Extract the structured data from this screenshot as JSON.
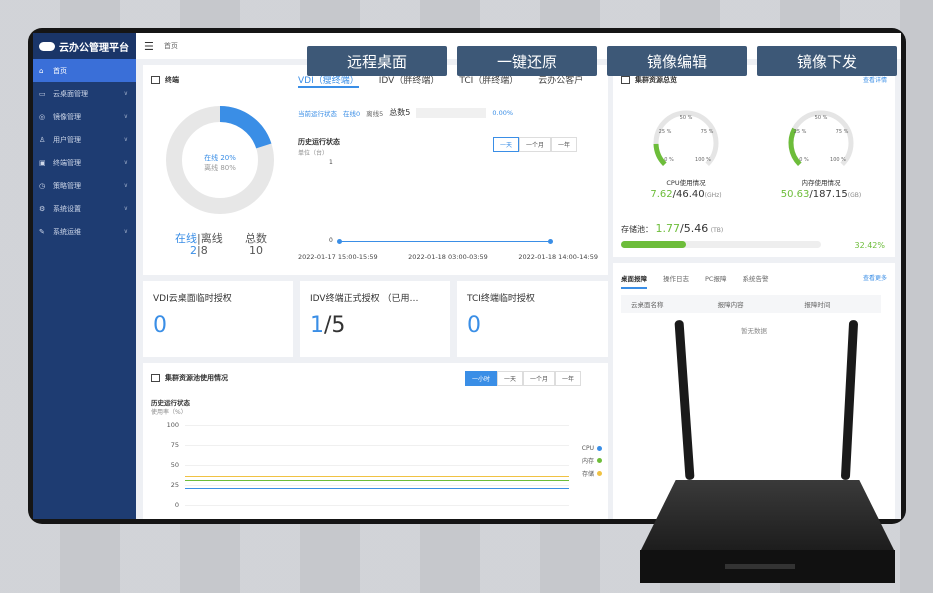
{
  "app": {
    "title": "云办公管理平台",
    "breadcrumb": "首页"
  },
  "sidebar": {
    "items": [
      {
        "label": "首页",
        "icon": "home-icon",
        "glyph": "⌂",
        "active": true
      },
      {
        "label": "云桌面管理",
        "icon": "monitor-icon",
        "glyph": "▭"
      },
      {
        "label": "镜像管理",
        "icon": "disc-icon",
        "glyph": "◎"
      },
      {
        "label": "用户管理",
        "icon": "user-icon",
        "glyph": "♙"
      },
      {
        "label": "终端管理",
        "icon": "terminal-icon",
        "glyph": "▣"
      },
      {
        "label": "策略管理",
        "icon": "clock-icon",
        "glyph": "◷"
      },
      {
        "label": "系统设置",
        "icon": "gear-icon",
        "glyph": "⚙"
      },
      {
        "label": "系统运维",
        "icon": "wrench-icon",
        "glyph": "✎"
      }
    ]
  },
  "banners": [
    "远程桌面",
    "一键还原",
    "镜像编辑",
    "镜像下发"
  ],
  "terminal": {
    "title": "终端",
    "tabs": [
      "VDI（瘦终端）",
      "IDV（胖终端）",
      "TCI（胖终端）",
      "云办公客户"
    ],
    "online_pct": "在线 20%",
    "offline_pct": "离线 80%",
    "online_fraction": 0.2,
    "online_label": "在线",
    "sep": "|",
    "offline_label": "离线",
    "total_label": "总数",
    "online": "2",
    "offline": "8",
    "total": "10",
    "status_line": {
      "label": "当前运行状态",
      "online": "在线0",
      "offline": "离线5",
      "total": "总数5",
      "pct": "0.00%"
    },
    "history": {
      "title": "历史运行状态",
      "unit": "单位（台）",
      "y_top": "1",
      "y_zero": "0",
      "ranges": [
        "一天",
        "一个月",
        "一年"
      ],
      "x_labels": [
        "2022-01-17 15:00-15:59",
        "2022-01-18 03:00-03:59",
        "2022-01-18 14:00-14:59"
      ]
    }
  },
  "licenses": [
    {
      "title": "VDI云桌面临时授权",
      "used": "0",
      "total": ""
    },
    {
      "title": "IDV终端正式授权 （已用…",
      "used": "1",
      "total": "/5"
    },
    {
      "title": "TCI终端临时授权",
      "used": "0",
      "total": ""
    }
  ],
  "pool": {
    "title": "集群资源池使用情况",
    "ranges": [
      "一小时",
      "一天",
      "一个月",
      "一年"
    ],
    "history_title": "历史运行状态",
    "unit": "使用率（%）",
    "y_ticks": [
      "100",
      "75",
      "50",
      "25",
      "0"
    ],
    "legend": [
      {
        "name": "CPU",
        "color": "#3a8ee6"
      },
      {
        "name": "内存",
        "color": "#6dbd3a"
      },
      {
        "name": "存储",
        "color": "#f0c243"
      }
    ]
  },
  "cluster": {
    "title": "集群资源总览",
    "detail_link": "查看详情",
    "gauge_labels": [
      "50 %",
      "25 %",
      "75 %",
      "0 %",
      "100 %"
    ],
    "cpu": {
      "label": "CPU使用情况",
      "used": "7.62",
      "total": "/46.40",
      "unit": "(GHz)",
      "fraction": 0.16
    },
    "mem": {
      "label": "内存使用情况",
      "used": "50.63",
      "total": "/187.15",
      "unit": "(GB)",
      "fraction": 0.27
    },
    "storage": {
      "label": "存储池：",
      "used": "1.77",
      "total": "/5.46",
      "unit": "(TB)",
      "pct": "32.42%",
      "fraction": 0.3242
    }
  },
  "alerts": {
    "tabs": [
      "桌面报障",
      "操作日志",
      "PC报障",
      "系统告警"
    ],
    "more": "查看更多",
    "columns": [
      "云桌面名称",
      "报障内容",
      "报障时间"
    ],
    "empty": "暂无数据"
  },
  "colors": {
    "accent": "#3a8ee6",
    "sidebar": "#1e3c72",
    "green": "#6dbd3a"
  }
}
